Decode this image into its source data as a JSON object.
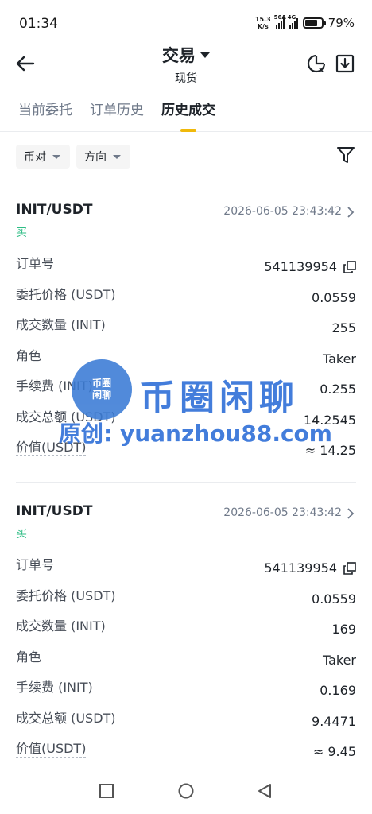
{
  "status": {
    "time": "01:34",
    "net_speed_top": "15.3",
    "net_speed_bottom": "K/s",
    "sig1_label": "56A",
    "sig2_label": "4G",
    "battery_percent": "79%",
    "battery_level": 0.79
  },
  "header": {
    "title": "交易",
    "subtitle": "现货",
    "icons": [
      "back-arrow-icon",
      "pie-chart-clock-icon",
      "download-icon"
    ]
  },
  "tabs": [
    {
      "label": "当前委托",
      "active": false
    },
    {
      "label": "订单历史",
      "active": false
    },
    {
      "label": "历史成交",
      "active": true
    }
  ],
  "filters": [
    {
      "label": "币对"
    },
    {
      "label": "方向"
    }
  ],
  "trades": [
    {
      "pair": "INIT/USDT",
      "side": "买",
      "datetime": "2026-06-05 23:43:42",
      "rows": [
        {
          "key": "订单号",
          "value": "541139954",
          "copy": true
        },
        {
          "key": "委托价格 (USDT)",
          "value": "0.0559"
        },
        {
          "key": "成交数量 (INIT)",
          "value": "255"
        },
        {
          "key": "角色",
          "value": "Taker"
        },
        {
          "key": "手续费 (INIT)",
          "value": "0.255"
        },
        {
          "key": "成交总额 (USDT)",
          "value": "14.2545"
        },
        {
          "key": "价值(USDT)",
          "value": "≈ 14.25",
          "dotted": true
        }
      ]
    },
    {
      "pair": "INIT/USDT",
      "side": "买",
      "datetime": "2026-06-05 23:43:42",
      "rows": [
        {
          "key": "订单号",
          "value": "541139954",
          "copy": true
        },
        {
          "key": "委托价格 (USDT)",
          "value": "0.0559"
        },
        {
          "key": "成交数量 (INIT)",
          "value": "169"
        },
        {
          "key": "角色",
          "value": "Taker"
        },
        {
          "key": "手续费 (INIT)",
          "value": "0.169"
        },
        {
          "key": "成交总额 (USDT)",
          "value": "9.4471"
        },
        {
          "key": "价值(USDT)",
          "value": "≈ 9.45",
          "dotted": true
        }
      ]
    }
  ],
  "watermark": {
    "badge_line1": "币圈",
    "badge_line2": "闲聊",
    "name": "币圈闲聊",
    "url": "原创: yuanzhou88.com"
  },
  "colors": {
    "accent": "#f0b90b",
    "buy": "#2ebd85",
    "watermark": "#2f6fd8"
  }
}
